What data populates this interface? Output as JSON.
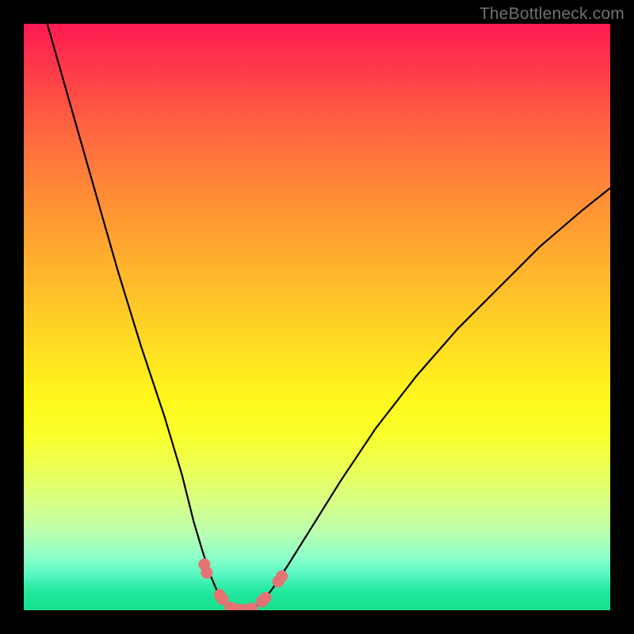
{
  "watermark": "TheBottleneck.com",
  "chart_data": {
    "type": "line",
    "title": "",
    "xlabel": "",
    "ylabel": "",
    "xlim": [
      0,
      100
    ],
    "ylim": [
      0,
      100
    ],
    "grid": false,
    "legend": false,
    "series": [
      {
        "name": "left-branch",
        "x": [
          4,
          8,
          12,
          16,
          20,
          24,
          27,
          29,
          30.5,
          31.8,
          33,
          34.3,
          35.3,
          36.2
        ],
        "y": [
          100,
          86,
          72,
          58,
          45,
          33,
          23,
          15,
          10,
          6,
          3.2,
          1.4,
          0.5,
          0.15
        ]
      },
      {
        "name": "right-branch",
        "x": [
          38.5,
          39.5,
          40.8,
          42.5,
          45,
          49,
          54,
          60,
          67,
          74,
          81,
          88,
          95,
          100
        ],
        "y": [
          0.15,
          0.6,
          1.6,
          3.8,
          7.6,
          14,
          22,
          31,
          40,
          48,
          55,
          62,
          68,
          72
        ]
      },
      {
        "name": "valley-floor",
        "x": [
          36.2,
          37,
          37.6,
          38.0,
          38.5
        ],
        "y": [
          0.15,
          0.05,
          0.03,
          0.05,
          0.15
        ]
      }
    ],
    "markers": [
      {
        "name": "left-dot-upper-a",
        "x": 30.8,
        "y": 7.8
      },
      {
        "name": "left-dot-upper-b",
        "x": 31.2,
        "y": 6.4
      },
      {
        "name": "left-dot-lower-a",
        "x": 33.4,
        "y": 2.6
      },
      {
        "name": "left-dot-lower-b",
        "x": 33.9,
        "y": 1.9
      },
      {
        "name": "floor-dot-a",
        "x": 35.2,
        "y": 0.45
      },
      {
        "name": "floor-dot-b",
        "x": 36.1,
        "y": 0.18
      },
      {
        "name": "floor-dot-c",
        "x": 37.1,
        "y": 0.06
      },
      {
        "name": "floor-dot-d",
        "x": 38.0,
        "y": 0.08
      },
      {
        "name": "floor-dot-e",
        "x": 38.9,
        "y": 0.3
      },
      {
        "name": "right-dot-lower-a",
        "x": 40.6,
        "y": 1.5
      },
      {
        "name": "right-dot-lower-b",
        "x": 41.2,
        "y": 2.1
      },
      {
        "name": "right-dot-upper-a",
        "x": 43.4,
        "y": 4.9
      },
      {
        "name": "right-dot-upper-b",
        "x": 44.0,
        "y": 5.8
      }
    ],
    "colors": {
      "curve": "#000000",
      "marker": "#e57373",
      "gradient_top": "#ff1a52",
      "gradient_mid": "#ffe022",
      "gradient_bottom": "#17e08f",
      "frame": "#000000"
    }
  }
}
